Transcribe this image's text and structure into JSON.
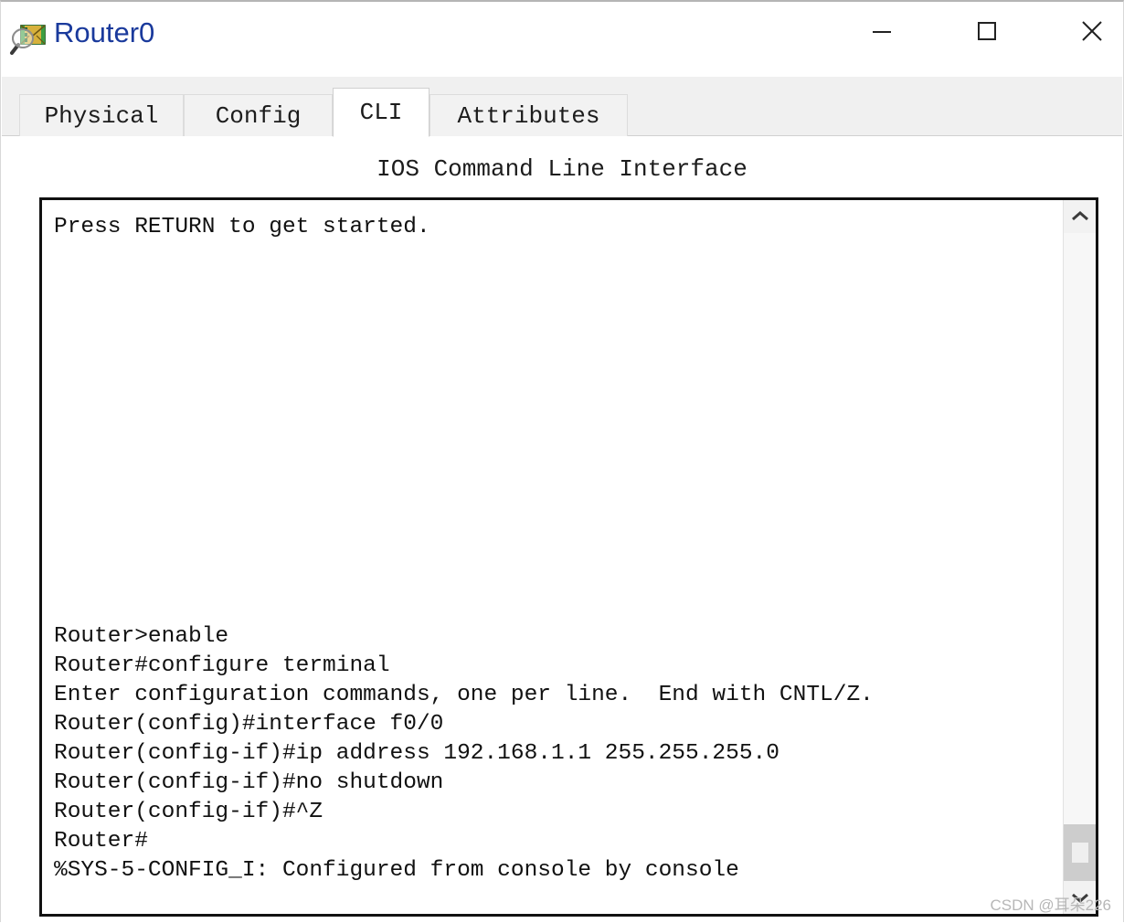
{
  "window": {
    "title": "Router0",
    "icon": "packet-tracer-inspect-icon",
    "title_color": "#1a3a9c",
    "controls": {
      "minimize": "—",
      "maximize": "□",
      "close": "✕"
    }
  },
  "tabs": [
    {
      "label": "Physical",
      "active": false
    },
    {
      "label": "Config",
      "active": false
    },
    {
      "label": "CLI",
      "active": true
    },
    {
      "label": "Attributes",
      "active": false
    }
  ],
  "main": {
    "header": "IOS Command Line Interface"
  },
  "terminal": {
    "lines": [
      "Press RETURN to get started.",
      "",
      "",
      "",
      "",
      "",
      "",
      "",
      "",
      "",
      "",
      "",
      "",
      "",
      "Router>enable",
      "Router#configure terminal",
      "Enter configuration commands, one per line.  End with CNTL/Z.",
      "Router(config)#interface f0/0",
      "Router(config-if)#ip address 192.168.1.1 255.255.255.0",
      "Router(config-if)#no shutdown",
      "Router(config-if)#^Z",
      "Router#",
      "%SYS-5-CONFIG_I: Configured from console by console"
    ],
    "text_color": "#111111",
    "background": "#ffffff"
  },
  "scrollbar": {
    "up_arrow": "scroll-up-icon",
    "down_arrow": "scroll-down-icon",
    "thumb_position": "near-bottom"
  },
  "watermark": {
    "text": "CSDN @耳朵226"
  }
}
